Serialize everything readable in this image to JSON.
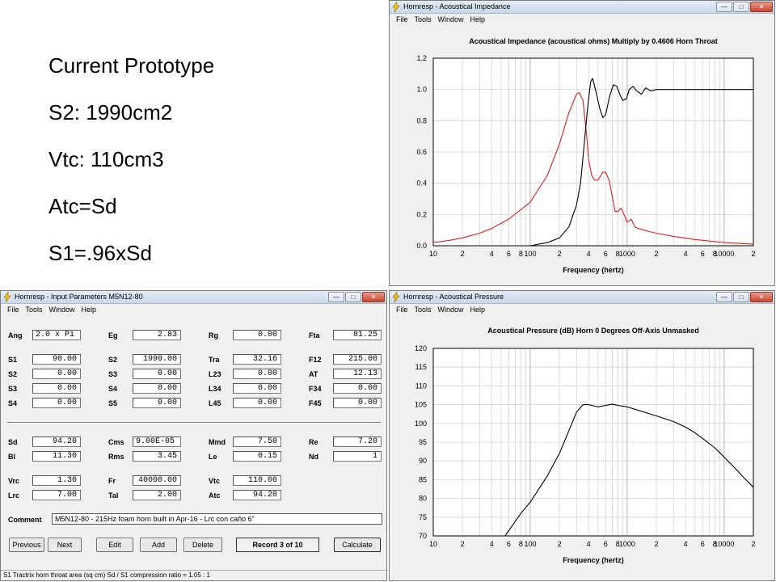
{
  "slide": {
    "lines": [
      "Current Prototype",
      "S2: 1990cm2",
      "Vtc: 110cm3",
      "Atc=Sd",
      "S1=.96xSd"
    ]
  },
  "common": {
    "menu": [
      "File",
      "Tools",
      "Window",
      "Help"
    ],
    "window_buttons": {
      "minimize": "—",
      "maximize": "□",
      "close": "✕"
    },
    "accent_colors": {
      "red_trace": "#e02020",
      "black_trace": "#000000",
      "grid": "#c8c8c8",
      "titlebar": "#c9d7ea"
    }
  },
  "impedance_window": {
    "title": "Hornresp - Acoustical Impedance",
    "chart_title": "Acoustical Impedance (acoustical ohms)   Multiply by 0.4606   Horn Throat",
    "xlabel": "Frequency (hertz)"
  },
  "pressure_window": {
    "title": "Hornresp - Acoustical Pressure",
    "chart_title": "Acoustical Pressure (dB)   Horn   0 Degrees Off-Axis   Unmasked",
    "xlabel": "Frequency (hertz)"
  },
  "input_window": {
    "title": "Hornresp - Input Parameters   M5N12-80",
    "params": {
      "Ang": "2.0 x Pi",
      "Eg": "2.83",
      "Rg": "0.00",
      "Fta": "81.25",
      "S1": "90.00",
      "S2": "1990.00",
      "Tra": "32.16",
      "F12": "215.00",
      "S2b": "0.00",
      "S3": "0.00",
      "L23": "0.00",
      "AT": "12.13",
      "S3b": "0.00",
      "S4": "0.00",
      "L34": "0.00",
      "F34": "0.00",
      "S4b": "0.00",
      "S5": "0.00",
      "L45": "0.00",
      "F45": "0.00",
      "Sd": "94.20",
      "Cms": "9.00E-05",
      "Mmd": "7.50",
      "Re": "7.20",
      "Bl": "11.30",
      "Rms": "3.45",
      "Le": "0.15",
      "Nd": "1",
      "Vrc": "1.30",
      "Fr": "40000.00",
      "Vtc": "110.00",
      "Lrc": "7.00",
      "Tal": "2.00",
      "Atc": "94.20"
    },
    "labels": {
      "Ang": "Ang",
      "Eg": "Eg",
      "Rg": "Rg",
      "Fta": "Fta",
      "S1": "S1",
      "S2": "S2",
      "Tra": "Tra",
      "F12": "F12",
      "S2b": "S2",
      "S3": "S3",
      "L23": "L23",
      "AT": "AT",
      "S3b": "S3",
      "S4": "S4",
      "L34": "L34",
      "F34": "F34",
      "S4b": "S4",
      "S5": "S5",
      "L45": "L45",
      "F45": "F45",
      "Sd": "Sd",
      "Cms": "Cms",
      "Mmd": "Mmd",
      "Re": "Re",
      "Bl": "Bl",
      "Rms": "Rms",
      "Le": "Le",
      "Nd": "Nd",
      "Vrc": "Vrc",
      "Fr": "Fr",
      "Vtc": "Vtc",
      "Lrc": "Lrc",
      "Tal": "Tal",
      "Atc": "Atc"
    },
    "comment_label": "Comment",
    "comment": "M5N12-80 - 215Hz foam horn built in Apr-16 - Lrc con caño 6\"",
    "buttons": {
      "previous": "Previous",
      "next": "Next",
      "edit": "Edit",
      "add": "Add",
      "delete": "Delete",
      "calculate": "Calculate"
    },
    "record": "Record 3 of 10",
    "status": "S1   Tractrix horn throat area  (sq cm)    Sd / S1 compression ratio = 1.05 : 1"
  },
  "chart_data": [
    {
      "type": "line",
      "title": "Acoustical Impedance (acoustical ohms)   Multiply by 0.4606   Horn Throat",
      "xlabel": "Frequency (hertz)",
      "ylabel": "",
      "xscale": "log",
      "xlim": [
        10,
        20000
      ],
      "ylim": [
        0,
        1.2
      ],
      "yticks": [
        "0.0",
        "0.2",
        "0.4",
        "0.6",
        "0.8",
        "1.0",
        "1.2"
      ],
      "xticks": [
        "10",
        "2",
        "4",
        "6",
        "8",
        "100",
        "2",
        "4",
        "6",
        "8",
        "1000",
        "2",
        "4",
        "6",
        "8",
        "10000",
        "2"
      ],
      "grid": true,
      "series": [
        {
          "color": "#e02020",
          "points": [
            [
              10,
              0.02
            ],
            [
              15,
              0.035
            ],
            [
              20,
              0.05
            ],
            [
              30,
              0.08
            ],
            [
              40,
              0.11
            ],
            [
              60,
              0.17
            ],
            [
              80,
              0.23
            ],
            [
              100,
              0.28
            ],
            [
              150,
              0.45
            ],
            [
              200,
              0.65
            ],
            [
              250,
              0.85
            ],
            [
              300,
              0.97
            ],
            [
              320,
              0.98
            ],
            [
              350,
              0.93
            ],
            [
              380,
              0.72
            ],
            [
              400,
              0.55
            ],
            [
              430,
              0.45
            ],
            [
              460,
              0.42
            ],
            [
              500,
              0.42
            ],
            [
              560,
              0.47
            ],
            [
              600,
              0.47
            ],
            [
              650,
              0.42
            ],
            [
              700,
              0.32
            ],
            [
              750,
              0.22
            ],
            [
              800,
              0.22
            ],
            [
              860,
              0.24
            ],
            [
              900,
              0.22
            ],
            [
              1000,
              0.15
            ],
            [
              1100,
              0.17
            ],
            [
              1200,
              0.12
            ],
            [
              1300,
              0.11
            ],
            [
              1500,
              0.1
            ],
            [
              1700,
              0.09
            ],
            [
              2000,
              0.08
            ],
            [
              3000,
              0.06
            ],
            [
              5000,
              0.04
            ],
            [
              10000,
              0.02
            ],
            [
              20000,
              0.01
            ]
          ]
        },
        {
          "color": "#000000",
          "points": [
            [
              50,
              0.0
            ],
            [
              100,
              0.0
            ],
            [
              150,
              0.02
            ],
            [
              200,
              0.05
            ],
            [
              250,
              0.12
            ],
            [
              300,
              0.26
            ],
            [
              330,
              0.4
            ],
            [
              360,
              0.65
            ],
            [
              390,
              0.88
            ],
            [
              420,
              1.05
            ],
            [
              440,
              1.07
            ],
            [
              470,
              1.0
            ],
            [
              520,
              0.88
            ],
            [
              560,
              0.82
            ],
            [
              600,
              0.84
            ],
            [
              660,
              0.96
            ],
            [
              720,
              1.03
            ],
            [
              780,
              1.02
            ],
            [
              850,
              0.96
            ],
            [
              900,
              0.93
            ],
            [
              980,
              0.94
            ],
            [
              1050,
              1.0
            ],
            [
              1150,
              1.02
            ],
            [
              1250,
              0.99
            ],
            [
              1400,
              0.97
            ],
            [
              1550,
              1.01
            ],
            [
              1750,
              0.99
            ],
            [
              2000,
              1.0
            ],
            [
              3000,
              1.0
            ],
            [
              20000,
              1.0
            ]
          ]
        }
      ]
    },
    {
      "type": "line",
      "title": "Acoustical Pressure (dB)   Horn   0 Degrees Off-Axis   Unmasked",
      "xlabel": "Frequency (hertz)",
      "ylabel": "",
      "xscale": "log",
      "xlim": [
        10,
        20000
      ],
      "ylim": [
        70,
        120
      ],
      "yticks": [
        "70",
        "75",
        "80",
        "85",
        "90",
        "95",
        "100",
        "105",
        "110",
        "115",
        "120"
      ],
      "xticks": [
        "10",
        "2",
        "4",
        "6",
        "8",
        "100",
        "2",
        "4",
        "6",
        "8",
        "1000",
        "2",
        "4",
        "6",
        "8",
        "10000",
        "2"
      ],
      "grid": true,
      "series": [
        {
          "color": "#000000",
          "points": [
            [
              55,
              70
            ],
            [
              80,
              76
            ],
            [
              100,
              79
            ],
            [
              150,
              86
            ],
            [
              200,
              92
            ],
            [
              250,
              98
            ],
            [
              300,
              103
            ],
            [
              350,
              105
            ],
            [
              400,
              105
            ],
            [
              500,
              104.4
            ],
            [
              600,
              104.8
            ],
            [
              700,
              105.1
            ],
            [
              800,
              104.8
            ],
            [
              1000,
              104.4
            ],
            [
              1500,
              103
            ],
            [
              2000,
              102
            ],
            [
              3000,
              100.5
            ],
            [
              4000,
              99
            ],
            [
              5000,
              97.5
            ],
            [
              6000,
              96
            ],
            [
              8000,
              93.5
            ],
            [
              10000,
              91
            ],
            [
              13000,
              88
            ],
            [
              16000,
              85.5
            ],
            [
              20000,
              83
            ]
          ]
        }
      ]
    }
  ]
}
